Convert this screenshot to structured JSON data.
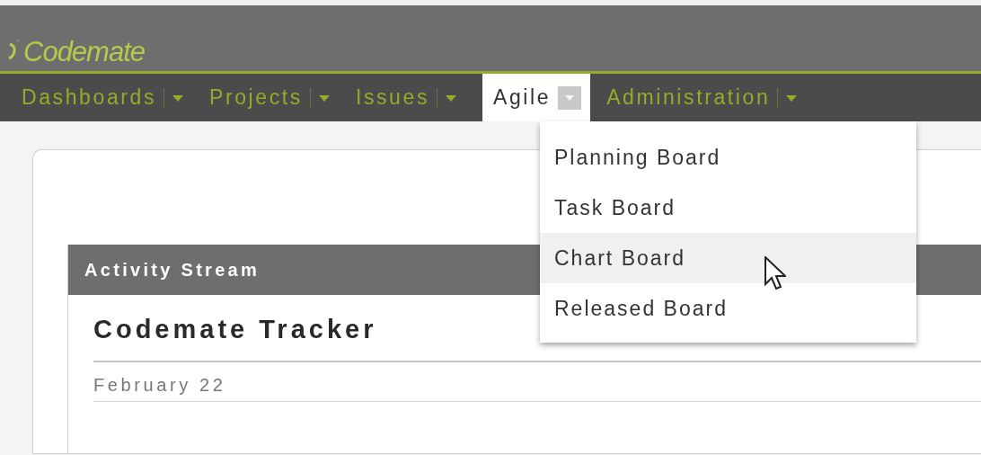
{
  "header": {
    "logo": "Codemate"
  },
  "nav": [
    {
      "label": "Dashboards",
      "selected": false,
      "expanded": false
    },
    {
      "label": "Projects",
      "selected": false,
      "expanded": false
    },
    {
      "label": "Issues",
      "selected": false,
      "expanded": false
    },
    {
      "label": "Agile",
      "selected": true,
      "expanded": true
    },
    {
      "label": "Administration",
      "selected": false,
      "expanded": false
    }
  ],
  "menu": [
    {
      "label": "Planning Board",
      "selected": false
    },
    {
      "label": "Task Board",
      "selected": false
    },
    {
      "label": "Chart Board",
      "selected": true
    },
    {
      "label": "Released Board",
      "selected": false
    }
  ],
  "panel": {
    "title": "Activity Stream",
    "heading": "Codemate Tracker",
    "date": "February 22"
  }
}
